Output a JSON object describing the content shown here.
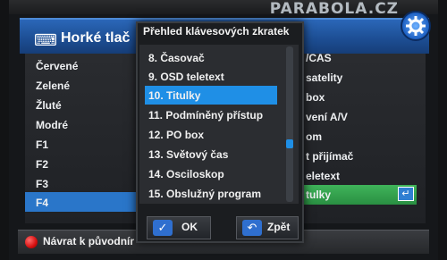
{
  "brand": "PARABOLA.CZ",
  "header": {
    "title": "Horké tlač",
    "icon": "keyboard-icon"
  },
  "left_list": [
    "Červené",
    "Zelené",
    "Žluté",
    "Modré",
    "F1",
    "F2",
    "F3",
    "F4"
  ],
  "left_selected": "F4",
  "right_list": [
    "/CAS",
    "satelity",
    "box",
    "vení A/V",
    "om",
    "t přijímač",
    "eletext",
    "tulky"
  ],
  "popup": {
    "title": "Přehled klávesových zkratek",
    "items": [
      "8.  Časovač",
      "9.  OSD teletext",
      "10.  Titulky",
      "11.  Podmíněný přístup",
      "12.  PO box",
      "13.  Světový čas",
      "14.  Osciloskop",
      "15.  Obslužný program"
    ],
    "selected_index": 2,
    "ok_label": "OK",
    "back_label": "Zpět"
  },
  "footer": {
    "label": "Návrat k původnír"
  },
  "colors": {
    "header": "#1d4f95",
    "highlight": "#1f8fe6",
    "green_row": "#2a8f42",
    "red_button": "#d60f0f"
  }
}
